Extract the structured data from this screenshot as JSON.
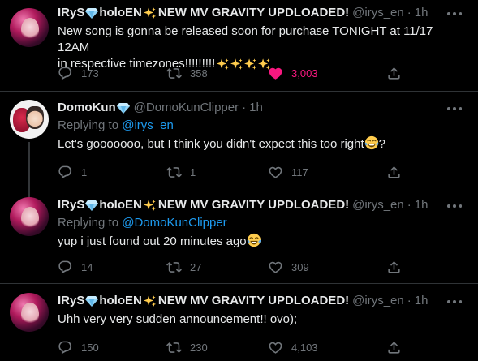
{
  "tweets": [
    {
      "avatar": "irys-avatar",
      "name": "IRyS",
      "name_suffix": "holoEN",
      "name_tail": "NEW MV GRAVITY UPDLOADED!",
      "handle": "@irys_en",
      "dot": "·",
      "time": "1h",
      "replying_prefix": "",
      "replying_to": "",
      "text_line1": "New song is gonna be released soon for purchase TONIGHT at 11/17 12AM",
      "text_line2": "in respective timezones!!!!!!!!!",
      "replies": "173",
      "retweets": "358",
      "likes": "3,003",
      "liked": true
    },
    {
      "avatar": "domokun-avatar",
      "name": "DomoKun",
      "handle": "@DomoKunClipper",
      "dot": "·",
      "time": "1h",
      "replying_prefix": "Replying to ",
      "replying_to": "@irys_en",
      "text": "Let's gooooooo, but I think you didn't expect this too right",
      "text_end": "?",
      "replies": "1",
      "retweets": "1",
      "likes": "117",
      "liked": false
    },
    {
      "avatar": "irys-avatar",
      "name": "IRyS",
      "name_suffix": "holoEN",
      "name_tail": "NEW MV GRAVITY UPDLOADED!",
      "handle": "@irys_en",
      "dot": "·",
      "time": "1h",
      "replying_prefix": "Replying to ",
      "replying_to": "@DomoKunClipper",
      "text": "yup i just found out 20 minutes ago",
      "replies": "14",
      "retweets": "27",
      "likes": "309",
      "liked": false
    },
    {
      "avatar": "irys-avatar",
      "name": "IRyS",
      "name_suffix": "holoEN",
      "name_tail": "NEW MV GRAVITY UPDLOADED!",
      "handle": "@irys_en",
      "dot": "·",
      "time": "1h",
      "replying_prefix": "",
      "replying_to": "",
      "text": "Uhh very very sudden announcement!! ovo);",
      "replies": "150",
      "retweets": "230",
      "likes": "4,103",
      "liked": false
    }
  ],
  "colors": {
    "background": "#000000",
    "text": "#e7e9ea",
    "muted": "#71767b",
    "link": "#1d9bf0",
    "like": "#f91880",
    "verified_gem": "#7fc8f2",
    "divider": "#2f3336"
  },
  "icons": [
    "gem-badge-icon",
    "sparkles-icon",
    "more-icon",
    "reply-icon",
    "retweet-icon",
    "like-icon",
    "share-icon",
    "joy-emoji-icon"
  ]
}
